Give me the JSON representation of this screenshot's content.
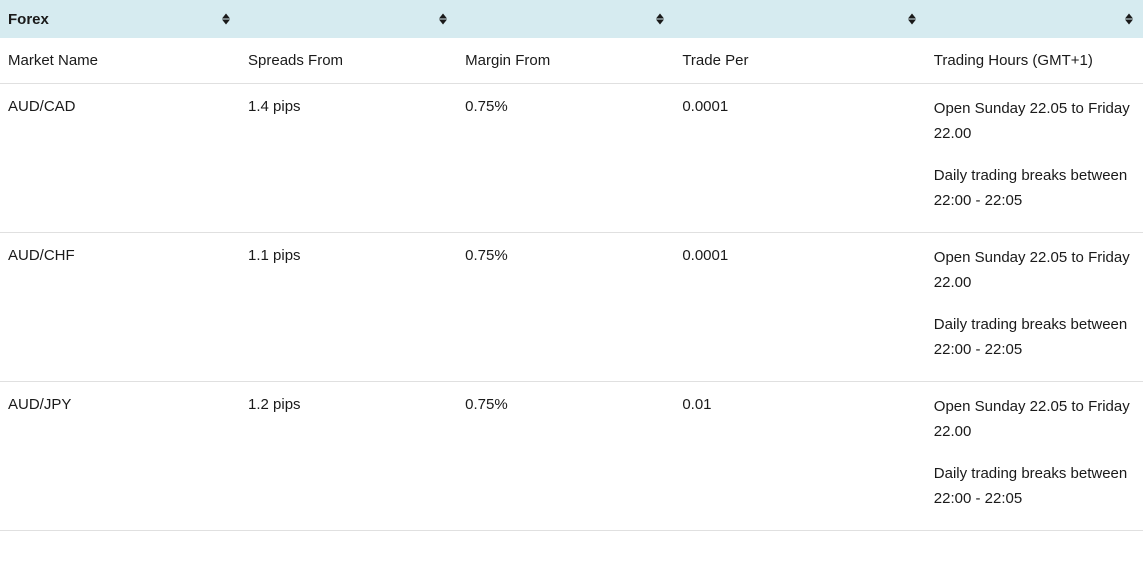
{
  "header": {
    "title": "Forex"
  },
  "columns": {
    "market_name": "Market Name",
    "spreads_from": "Spreads From",
    "margin_from": "Margin From",
    "trade_per": "Trade Per",
    "trading_hours": "Trading Hours (GMT+1)"
  },
  "rows": [
    {
      "market_name": "AUD/CAD",
      "spreads_from": "1.4 pips",
      "margin_from": "0.75%",
      "trade_per": "0.0001",
      "hours_line1": "Open Sunday 22.05 to Friday",
      "hours_line2": "22.00",
      "hours_line3": "Daily trading breaks between",
      "hours_line4": "22:00 - 22:05"
    },
    {
      "market_name": "AUD/CHF",
      "spreads_from": "1.1 pips",
      "margin_from": "0.75%",
      "trade_per": "0.0001",
      "hours_line1": "Open Sunday 22.05 to Friday",
      "hours_line2": "22.00",
      "hours_line3": "Daily trading breaks between",
      "hours_line4": "22:00 - 22:05"
    },
    {
      "market_name": "AUD/JPY",
      "spreads_from": "1.2 pips",
      "margin_from": "0.75%",
      "trade_per": "0.01",
      "hours_line1": "Open Sunday 22.05 to Friday",
      "hours_line2": "22.00",
      "hours_line3": "Daily trading breaks between",
      "hours_line4": "22:00 - 22:05"
    }
  ]
}
